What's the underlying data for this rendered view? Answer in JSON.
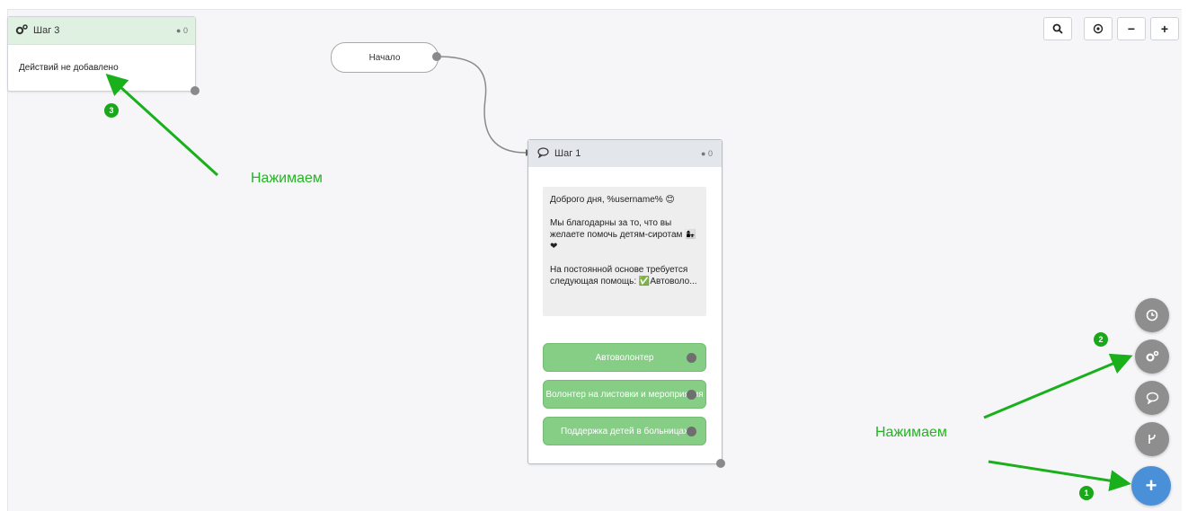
{
  "toolbar": {
    "search_icon": "search-icon",
    "center_icon": "target-icon",
    "zoom_out_label": "−",
    "zoom_in_label": "+"
  },
  "start_node": {
    "label": "Начало"
  },
  "step3": {
    "title": "Шаг 3",
    "count": "0",
    "body_text": "Действий не добавлено"
  },
  "step1": {
    "title": "Шаг 1",
    "count": "0",
    "message": {
      "line1": "Доброго дня, %username% 😊",
      "line2": "Мы благодарны за то, что вы желаете помочь детям-сиротам 👩‍👧 ❤",
      "line3": "На постоянной основе требуется следующая помощь: ✅Автоволо..."
    },
    "buttons": [
      {
        "label": "Автоволонтер"
      },
      {
        "label": "Волонтер на листовки и мероприятия"
      },
      {
        "label": "Поддержка детей в больницах"
      }
    ]
  },
  "fabs": {
    "timer": "clock-icon",
    "settings": "gears-icon",
    "message": "chat-icon",
    "branch": "branch-icon",
    "add_label": "+"
  },
  "annotations": {
    "press_label_1": "Нажимаем",
    "press_label_2": "Нажимаем",
    "badge_1": "1",
    "badge_2": "2",
    "badge_3": "3",
    "arrow_color": "#19b01b"
  },
  "colors": {
    "accent_blue": "#4a90d9",
    "answer_green": "#86cd86",
    "step3_header": "#dff2e1",
    "step1_header": "#e3e7ec"
  }
}
